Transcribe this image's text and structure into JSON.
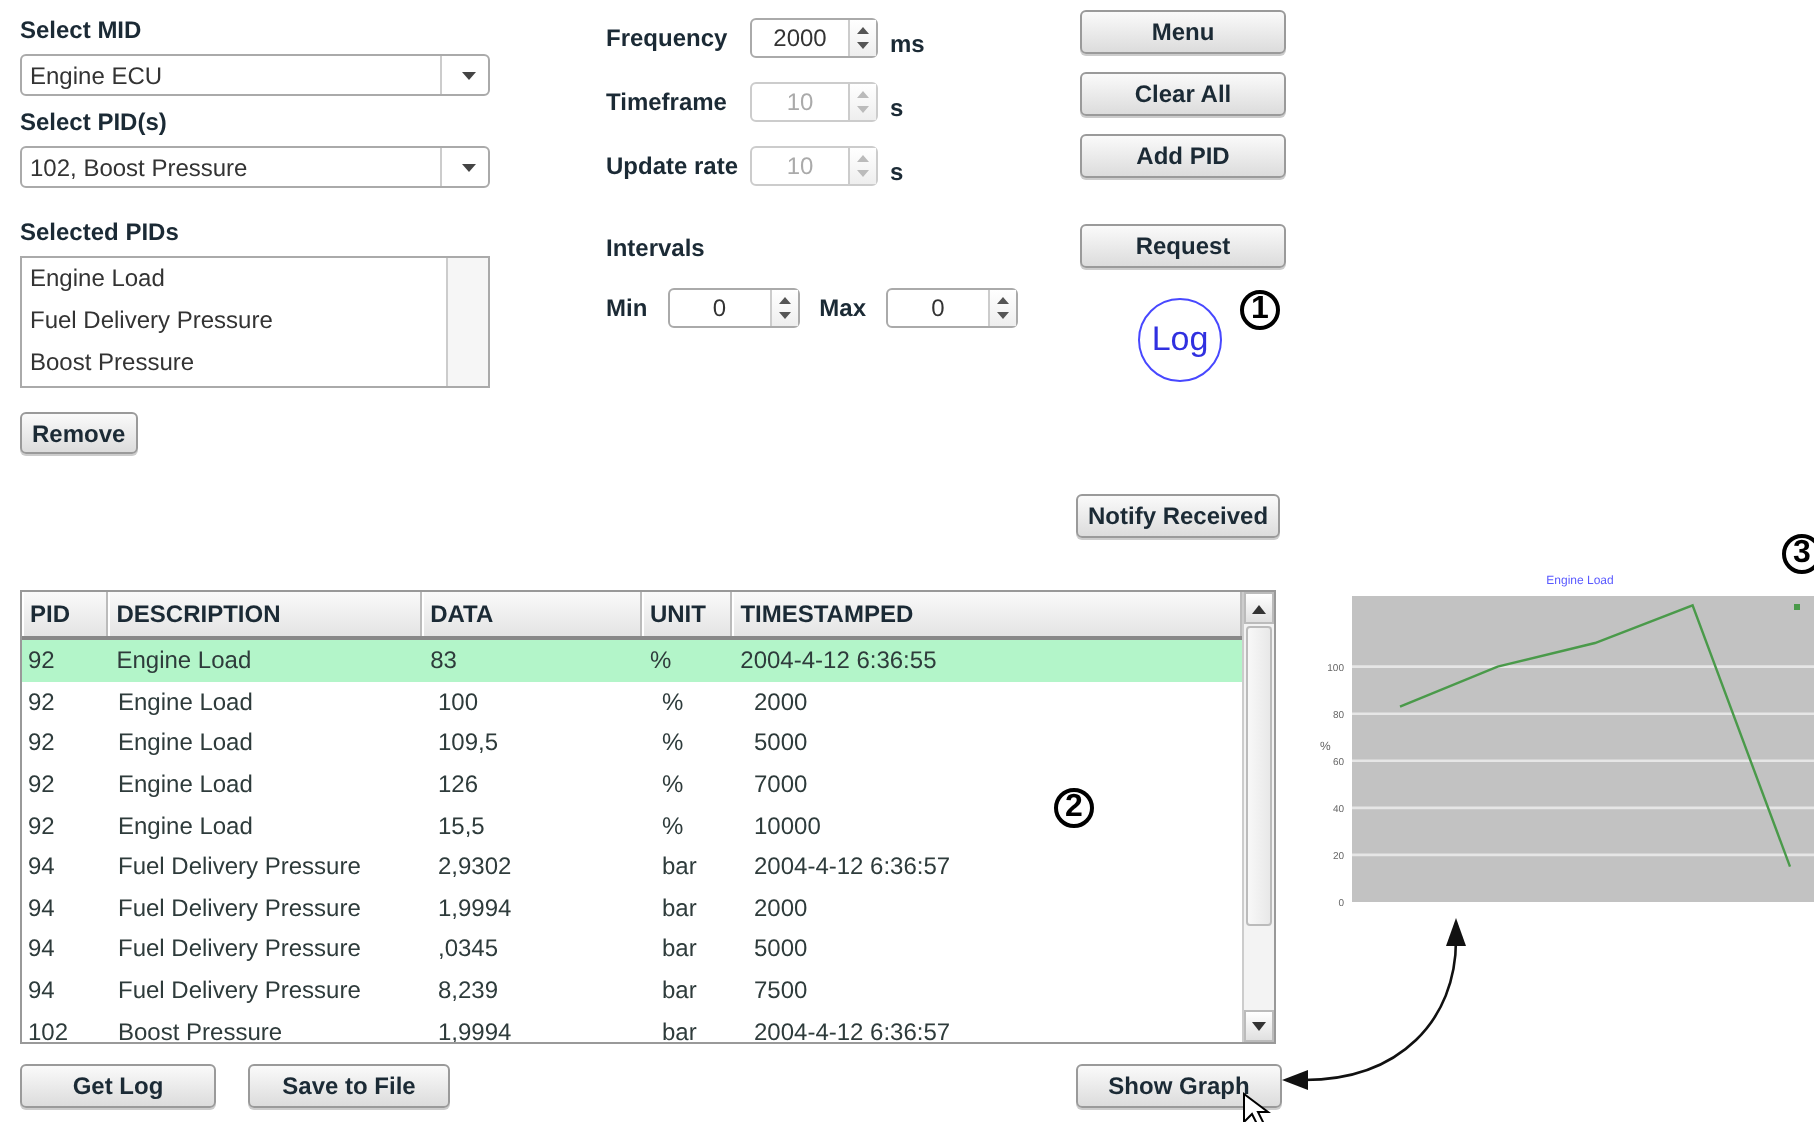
{
  "mid": {
    "label": "Select MID",
    "value": "Engine ECU"
  },
  "pid": {
    "label": "Select PID(s)",
    "value": "102, Boost Pressure"
  },
  "selected_pids": {
    "label": "Selected PIDs",
    "items": [
      "Engine Load",
      "Fuel Delivery Pressure",
      "Boost Pressure"
    ]
  },
  "remove_button": "Remove",
  "settings": [
    {
      "label": "Frequency",
      "value": "2000",
      "unit": "ms",
      "disabled": false
    },
    {
      "label": "Timeframe",
      "value": "10",
      "unit": "s",
      "disabled": true
    },
    {
      "label": "Update rate",
      "value": "10",
      "unit": "s",
      "disabled": true
    }
  ],
  "intervals": {
    "title": "Intervals",
    "fields": [
      {
        "label": "Min",
        "value": "0"
      },
      {
        "label": "Max",
        "value": "0"
      }
    ]
  },
  "side_buttons": [
    "Menu",
    "Clear All",
    "Add PID"
  ],
  "request_button": "Request",
  "log_badge": "Log",
  "notify_button": "Notify Received",
  "callouts": [
    "1",
    "2",
    "3"
  ],
  "table": {
    "columns": [
      "PID",
      "DESCRIPTION",
      "DATA",
      "UNIT",
      "TIMESTAMPED"
    ],
    "rows": [
      {
        "cells": [
          "92",
          "Engine Load",
          "83",
          "%",
          "2004-4-12 6:36:55"
        ],
        "selected": true
      },
      {
        "cells": [
          "92",
          "Engine Load",
          "100",
          "%",
          "2000"
        ],
        "selected": false
      },
      {
        "cells": [
          "92",
          "Engine Load",
          "109,5",
          "%",
          "5000"
        ],
        "selected": false
      },
      {
        "cells": [
          "92",
          "Engine Load",
          "126",
          "%",
          "7000"
        ],
        "selected": false
      },
      {
        "cells": [
          "92",
          "Engine Load",
          "15,5",
          "%",
          "10000"
        ],
        "selected": false
      },
      {
        "cells": [
          "94",
          "Fuel Delivery Pressure",
          "2,9302",
          "bar",
          "2004-4-12 6:36:57"
        ],
        "selected": false
      },
      {
        "cells": [
          "94",
          "Fuel Delivery Pressure",
          "1,9994",
          "bar",
          "2000"
        ],
        "selected": false
      },
      {
        "cells": [
          "94",
          "Fuel Delivery Pressure",
          ",0345",
          "bar",
          "5000"
        ],
        "selected": false
      },
      {
        "cells": [
          "94",
          "Fuel Delivery Pressure",
          "8,239",
          "bar",
          "7500"
        ],
        "selected": false
      },
      {
        "cells": [
          "102",
          "Boost Pressure",
          "1,9994",
          "bar",
          "2004-4-12 6:36:57"
        ],
        "selected": false
      }
    ]
  },
  "bottom_buttons": [
    "Get Log",
    "Save to File"
  ],
  "graph_button": "Show Graph",
  "graph": {
    "chart_data": {
      "type": "line",
      "title": "Engine Load",
      "ylabel": "%",
      "ylim": [
        0,
        130
      ],
      "yticks": [
        0,
        20,
        40,
        60,
        80,
        100
      ],
      "grid": true,
      "series": [
        {
          "color": "#4a9a4a",
          "values": [
            83,
            100,
            110,
            126,
            15
          ]
        }
      ]
    }
  }
}
